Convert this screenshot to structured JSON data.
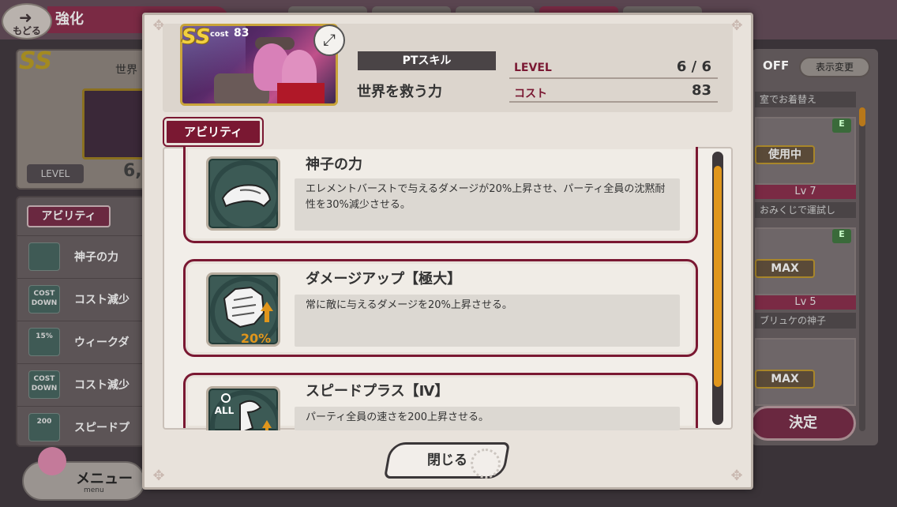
{
  "background": {
    "back_label": "もどる",
    "title": "強化",
    "world_label": "世界",
    "rarity": "SS",
    "level_label": "LEVEL",
    "level_value": "6,",
    "ability_tag": "アビリティ",
    "ability_rows": [
      {
        "icon": "goggles-icon",
        "icon_text": "",
        "label": "神子の力"
      },
      {
        "icon": "cost-down-icon",
        "icon_text": "COST DOWN",
        "label": "コスト減少"
      },
      {
        "icon": "weak-icon",
        "icon_text": "15%",
        "label": "ウィークダ"
      },
      {
        "icon": "cost-down-icon",
        "icon_text": "COST DOWN",
        "label": "コスト減少"
      },
      {
        "icon": "speed-icon",
        "icon_text": "200",
        "label": "スピードプ"
      }
    ],
    "menu_label": "メニュー",
    "menu_sub": "menu",
    "off_label": "OFF",
    "display_toggle": "表示変更",
    "notes": [
      "室でお着替え",
      "おみくじで運試し",
      "ブリュケの神子"
    ],
    "in_use": "使用中",
    "lv1": "Lv 7",
    "lv2": "Lv 5",
    "max1": "MAX",
    "max2": "MAX",
    "badge_e": "E",
    "decide": "決定"
  },
  "dialog": {
    "card": {
      "rarity": "SS",
      "cost_label": "cost",
      "cost_value": "83"
    },
    "expand_icon": "expand-icon",
    "skill_type": "PTスキル",
    "skill_name": "世界を救う力",
    "stats": [
      {
        "key": "LEVEL",
        "value": "6 / 6"
      },
      {
        "key": "コスト",
        "value": "83"
      }
    ],
    "abilities_tab": "アビリティ",
    "abilities": [
      {
        "name": "神子の力",
        "desc": "エレメントバーストで与えるダメージが20%上昇させ、パーティ全員の沈黙耐性を30%減少させる。",
        "icon": "goggles-icon"
      },
      {
        "name": "ダメージアップ【極大】",
        "desc": "常に敵に与えるダメージを20%上昇させる。",
        "icon": "fist-up-icon",
        "icon_text": "20%"
      },
      {
        "name": "スピードプラス【Ⅳ】",
        "desc": "パーティ全員の速さを200上昇させる。",
        "icon": "speed-all-icon",
        "icon_text": "ALL"
      }
    ],
    "close_label": "閉じる"
  },
  "colors": {
    "accent": "#7a1832",
    "scroll": "#e0961c",
    "gold": "#c9a43a"
  }
}
